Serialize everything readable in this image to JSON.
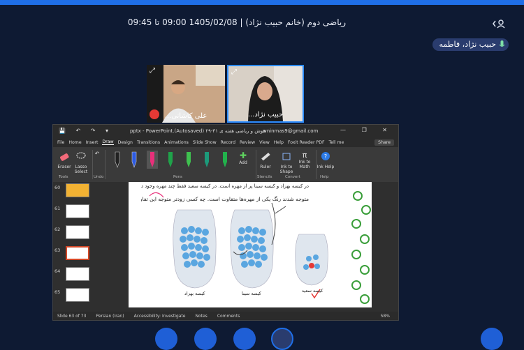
{
  "header": {
    "title": "ریاضی دوم (خانم حبیب نژاد) | 1405/02/08 09:00 تا 09:45",
    "user_icon": "user-icon"
  },
  "speaker_pill": {
    "label": "حبیب نژاد، فاطمه",
    "icon": "mic-icon"
  },
  "participants": [
    {
      "name": "علی کاشانی..."
    },
    {
      "name": "حبیب نژاد..."
    }
  ],
  "powerpoint": {
    "title": "هوش و ریاضی هفته ی ۳۱-۲۹ (Autosaved).pptx - PowerPoint",
    "user": "wninmas9@gmail.com",
    "menu": [
      "File",
      "Home",
      "Insert",
      "Draw",
      "Design",
      "Transitions",
      "Animations",
      "Slide Show",
      "Record",
      "Review",
      "View",
      "Help",
      "Foxit Reader PDF",
      "Tell me"
    ],
    "active_menu": "Draw",
    "share": "Share",
    "tools": {
      "eraser": "Eraser",
      "lasso": "Lasso Select",
      "add": "Add",
      "ruler": "Ruler",
      "ink_to_shape": "Ink to Shape",
      "ink_to_math": "Ink to Math",
      "ink_help": "Ink Help"
    },
    "groups": {
      "tools": "Tools",
      "undo": "Undo",
      "pens": "Pens",
      "stencils": "Stencils",
      "convert": "Convert",
      "help": "Help"
    },
    "thumb_numbers": [
      "60",
      "61",
      "62",
      "63",
      "64",
      "65"
    ],
    "slide": {
      "line1": "در کیسه بهزاد و کیسه سینا پر از مهره است. در کیسه سعید فقط چند مهره وجود دارد.",
      "line2": "متوجه شدند رنگ یکی از مهره‌ها متفاوت است. چه کسی زودتر متوجه این تفاوت شد؟",
      "bags": [
        "کیسه بهزاد",
        "کیسه سینا",
        "کیسه سعید"
      ]
    },
    "status": {
      "slide": "Slide 63 of 73",
      "language": "Persian (Iran)",
      "accessibility": "Accessibility: Investigate",
      "notes": "Notes",
      "comments": "Comments",
      "zoom": "58%"
    }
  }
}
